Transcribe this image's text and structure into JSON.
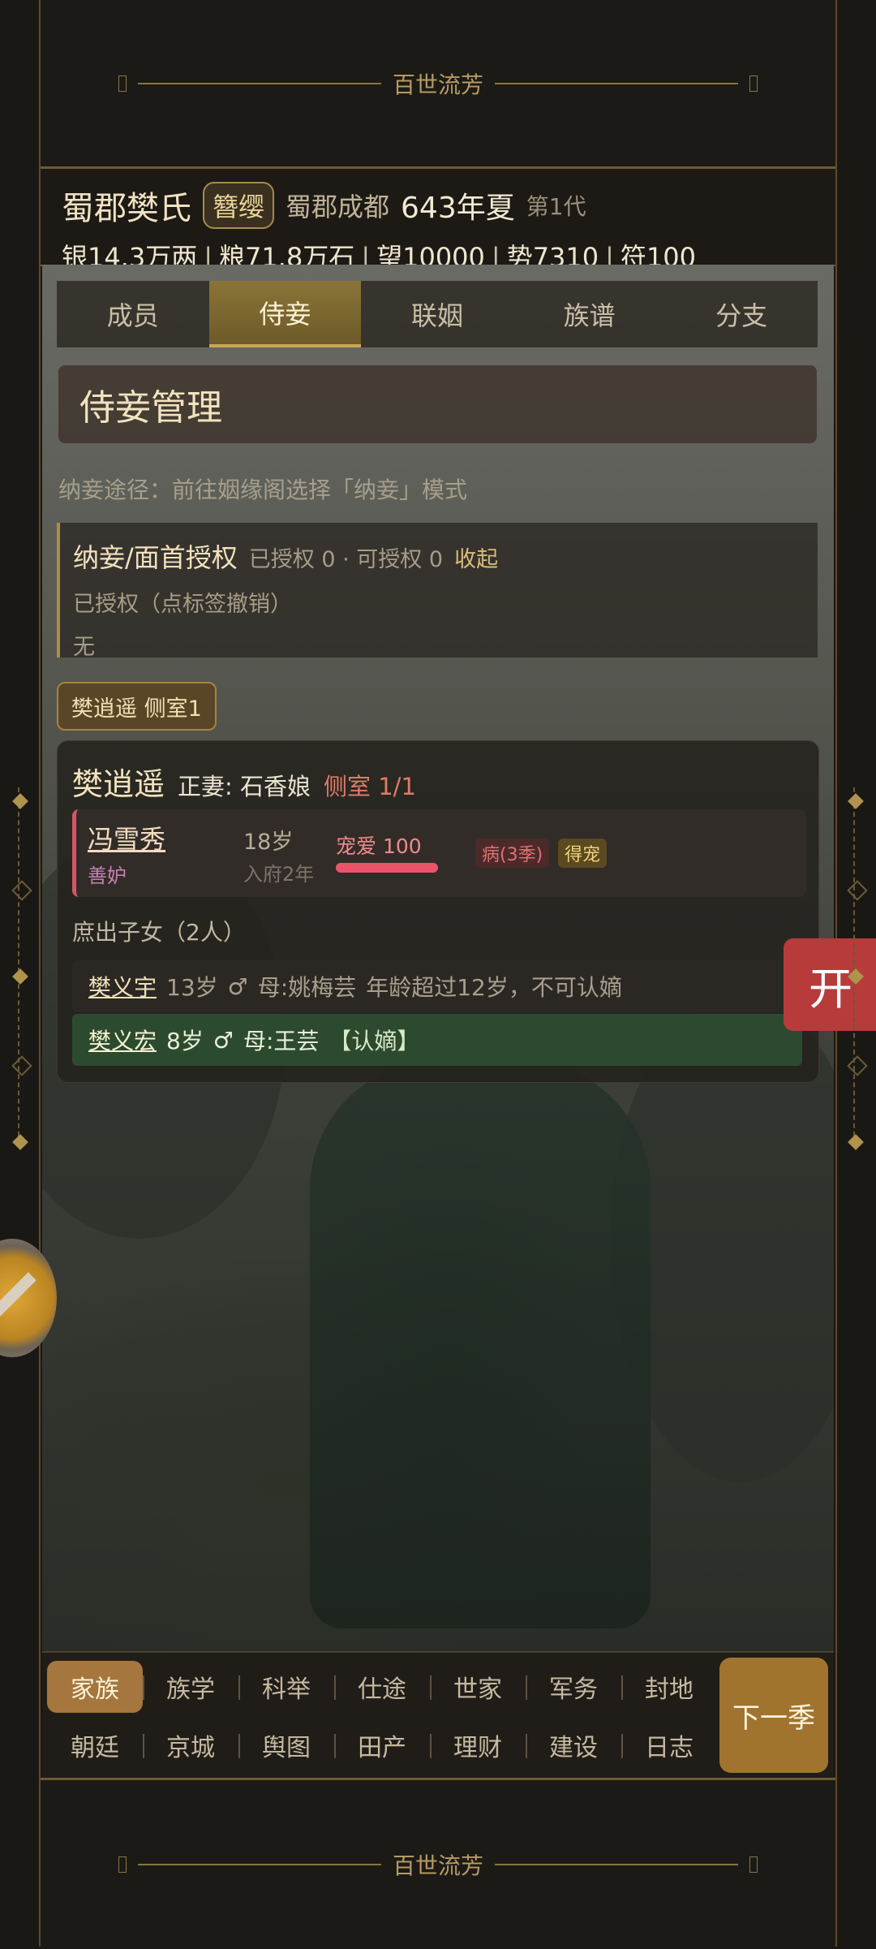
{
  "banner": {
    "title": "百世流芳"
  },
  "header": {
    "clan_name": "蜀郡樊氏",
    "rank_badge": "簪缨",
    "location": "蜀郡成都",
    "date": "643年夏",
    "generation": "第1代",
    "resources": [
      {
        "label": "银14.3万两"
      },
      {
        "label": "粮71.8万石"
      },
      {
        "label": "望10000"
      },
      {
        "label": "势7310"
      },
      {
        "label": "符100"
      }
    ]
  },
  "tabs": [
    {
      "label": "成员"
    },
    {
      "label": "侍妾",
      "active": true
    },
    {
      "label": "联姻"
    },
    {
      "label": "族谱"
    },
    {
      "label": "分支"
    }
  ],
  "section_title": "侍妾管理",
  "hint": "纳妾途径：前往姻缘阁选择「纳妾」模式",
  "auth": {
    "title": "纳妾/面首授权",
    "counts": "已授权 0 · 可授权 0",
    "collapse": "收起",
    "subtitle": "已授权（点标签撤销）",
    "empty": "无"
  },
  "filter_chip": "樊逍遥 侧室1",
  "card": {
    "lord": "樊逍遥",
    "spouse": "正妻: 石香娘",
    "concubine_count": "侧室 1/1",
    "concubine": {
      "name": "冯雪秀",
      "trait": "善妒",
      "age": "18岁",
      "years": "入府2年",
      "favor_label": "宠爱 100",
      "favor_value": 100,
      "tags": [
        "病(3季)",
        "得宠"
      ]
    },
    "children_title": "庶出子女（2人）",
    "children": [
      {
        "name": "樊义宇",
        "age": "13岁",
        "gender": "♂",
        "mother": "母:姚梅芸",
        "note": "年龄超过12岁，不可认嫡"
      },
      {
        "name": "樊义宏",
        "age": "8岁",
        "gender": "♂",
        "mother": "母:王芸",
        "note": "【认嫡】"
      }
    ]
  },
  "open_button": "开",
  "nav": {
    "row1": [
      {
        "label": "家族",
        "active": true
      },
      {
        "label": "族学"
      },
      {
        "label": "科举"
      },
      {
        "label": "仕途"
      },
      {
        "label": "世家"
      },
      {
        "label": "军务"
      },
      {
        "label": "封地"
      }
    ],
    "row2": [
      {
        "label": "朝廷"
      },
      {
        "label": "京城"
      },
      {
        "label": "舆图"
      },
      {
        "label": "田产"
      },
      {
        "label": "理财"
      },
      {
        "label": "建设"
      },
      {
        "label": "日志"
      }
    ],
    "next": "下一季"
  },
  "colors": {
    "accent": "#a5763d",
    "favor": "#ea5469",
    "recognize_bg": "#2c4a30",
    "open_button": "#b83b3b"
  }
}
